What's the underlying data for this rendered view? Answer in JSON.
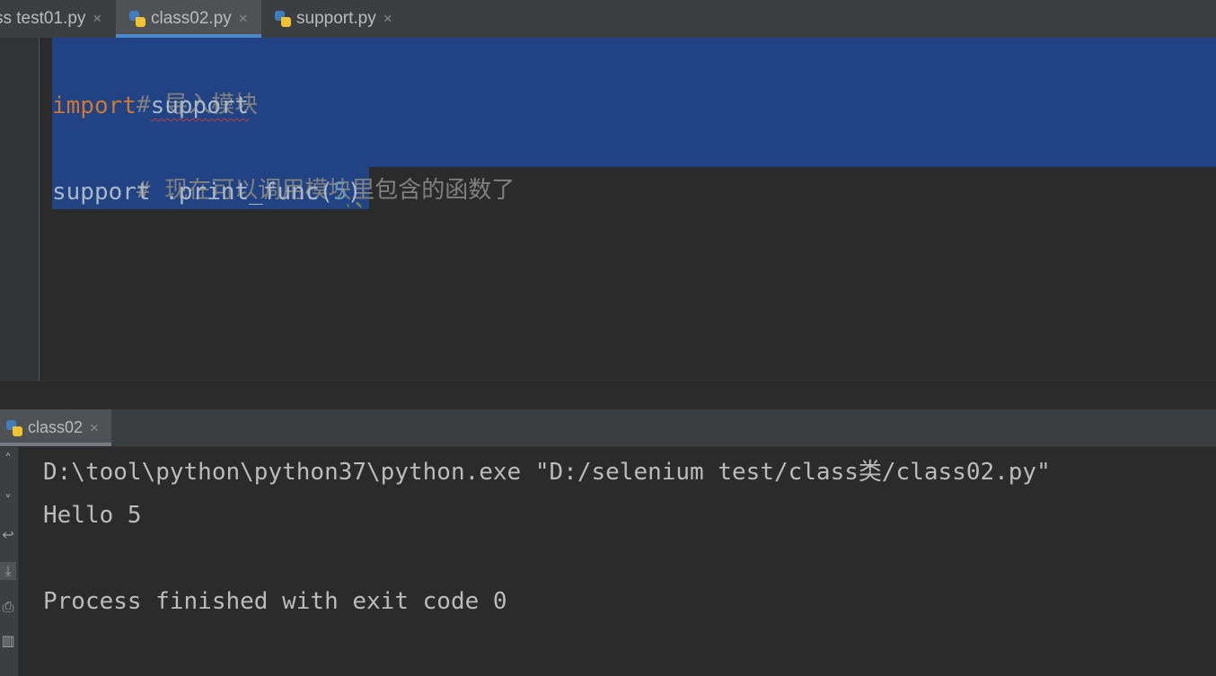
{
  "editor_tabs": [
    {
      "label": "ss test01.py",
      "close": "×",
      "active": false
    },
    {
      "label": "class02.py",
      "close": "×",
      "active": true
    },
    {
      "label": "support.py",
      "close": "×",
      "active": false
    }
  ],
  "code": {
    "line1_comment": "# 导入模块",
    "line2_keyword": "import",
    "line2_module": "support",
    "line3_comment": "# 现在可以调用模块里包含的函数了",
    "line4_obj": "support",
    "line4_call": " .print_func(",
    "line4_arg": "5",
    "line4_close": ")"
  },
  "run_tab": {
    "label": "class02",
    "close": "×"
  },
  "run_toolbar_icons": [
    "up-arrow-icon",
    "down-arrow-icon",
    "soft-wrap-icon",
    "scroll-to-end-icon",
    "print-icon",
    "trash-icon"
  ],
  "console": {
    "line1": "D:\\tool\\python\\python37\\python.exe \"D:/selenium test/class类/class02.py\"",
    "line2": "Hello 5",
    "line3": "",
    "line4": "Process finished with exit code 0"
  },
  "colors": {
    "background": "#2b2b2b",
    "selection": "#214283",
    "keyword": "#cc7832",
    "comment": "#808080",
    "number": "#6897bb",
    "tab_accent": "#4a88c7"
  }
}
